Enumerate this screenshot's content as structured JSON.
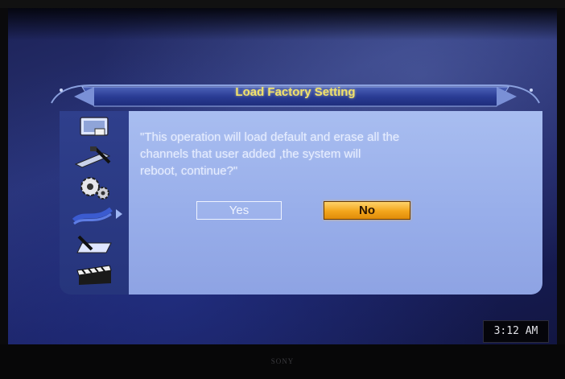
{
  "dialog": {
    "title": "Load Factory Setting",
    "message": "\"This operation will load default and erase all the\n channels that user added ,the system will\nreboot, continue?\"",
    "buttons": {
      "yes": "Yes",
      "no": "No"
    },
    "focused_button": "No"
  },
  "sidebar": {
    "icons": [
      "monitor-settings-icon",
      "tools-icon",
      "gears-icon",
      "cable-icon",
      "pen-tablet-icon",
      "clapperboard-icon"
    ],
    "selected_index": 3
  },
  "status": {
    "clock": "3:12 AM"
  },
  "bezel": {
    "brand": "SONY"
  },
  "colors": {
    "title": "#f2e26a",
    "panel": "#98aeea",
    "focus": "#f3a51b"
  }
}
